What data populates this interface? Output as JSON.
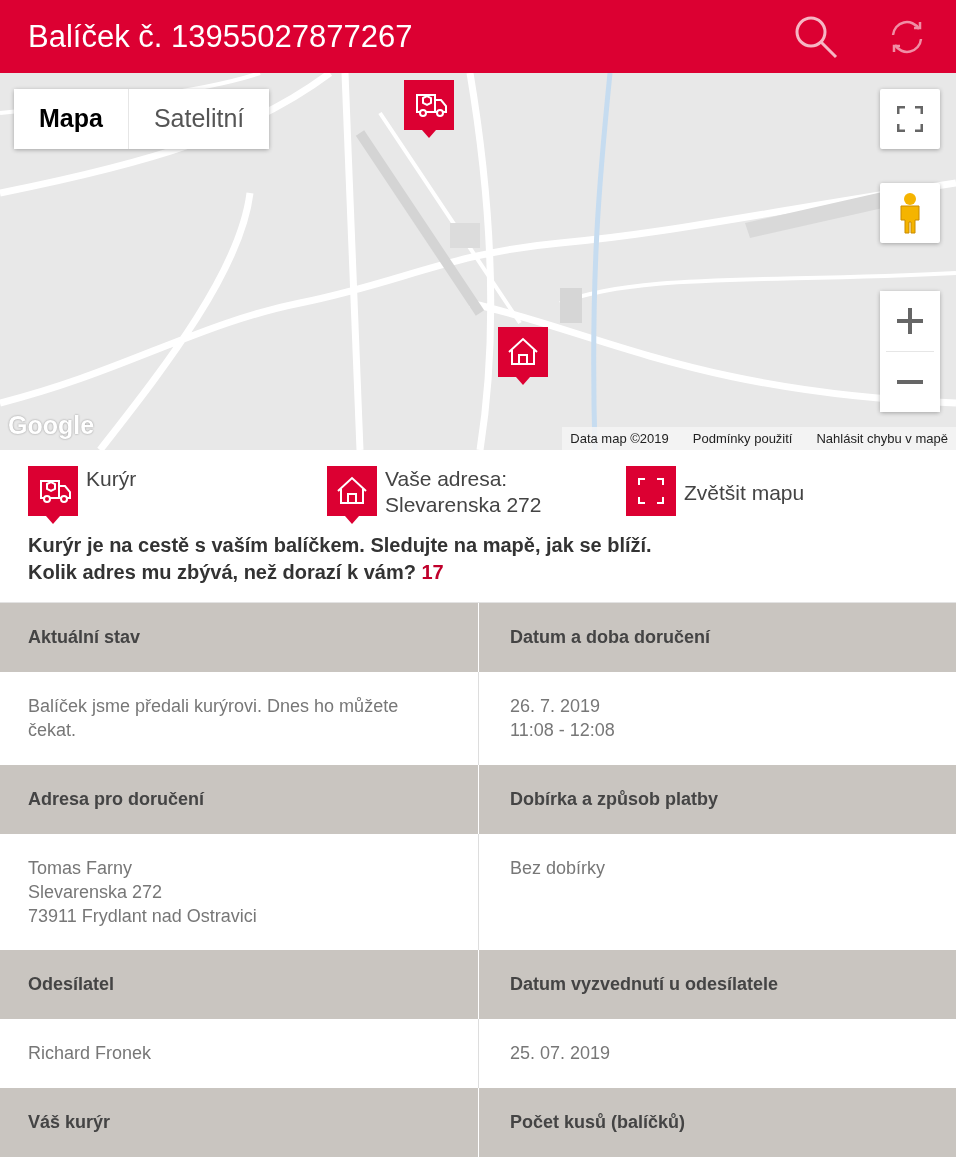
{
  "header": {
    "title": "Balíček č. 13955027877267"
  },
  "map": {
    "map_types": [
      {
        "label": "Mapa",
        "selected": true
      },
      {
        "label": "Satelitní",
        "selected": false
      }
    ],
    "logo": "Google",
    "attribution": [
      "Data map ©2019",
      "Podmínky použití",
      "Nahlásit chybu v mapě"
    ]
  },
  "legend": [
    {
      "kind": "courier",
      "lines": [
        "Kurýr"
      ]
    },
    {
      "kind": "home",
      "lines": [
        "Vaše adresa:",
        "Slevarenska 272"
      ]
    },
    {
      "kind": "expand",
      "lines": [
        "Zvětšit mapu"
      ]
    }
  ],
  "message": {
    "lines": [
      "Kurýr je na cestě s vaším balíčkem. Sledujte na mapě, jak se blíží.",
      "Kolik adres mu zbývá, než dorazí k vám?"
    ],
    "count": "17"
  },
  "details": [
    {
      "heading": "Aktuální stav",
      "lines": [
        "Balíček jsme předali kurýrovi. Dnes ho můžete čekat."
      ]
    },
    {
      "heading": "Datum a doba doručení",
      "lines": [
        "26. 7. 2019",
        "11:08 - 12:08"
      ]
    },
    {
      "heading": "Adresa pro doručení",
      "lines": [
        "Tomas Farny",
        "Slevarenska 272",
        "73911 Frydlant nad Ostravici"
      ]
    },
    {
      "heading": "Dobírka a způsob platby",
      "lines": [
        "Bez dobírky"
      ]
    },
    {
      "heading": "Odesílatel",
      "lines": [
        "Richard Fronek"
      ]
    },
    {
      "heading": "Datum vyzvednutí u odesílatele",
      "lines": [
        "25. 07. 2019"
      ]
    },
    {
      "heading": "Váš kurýr"
    },
    {
      "heading": "Počet kusů (balíčků)"
    }
  ]
}
